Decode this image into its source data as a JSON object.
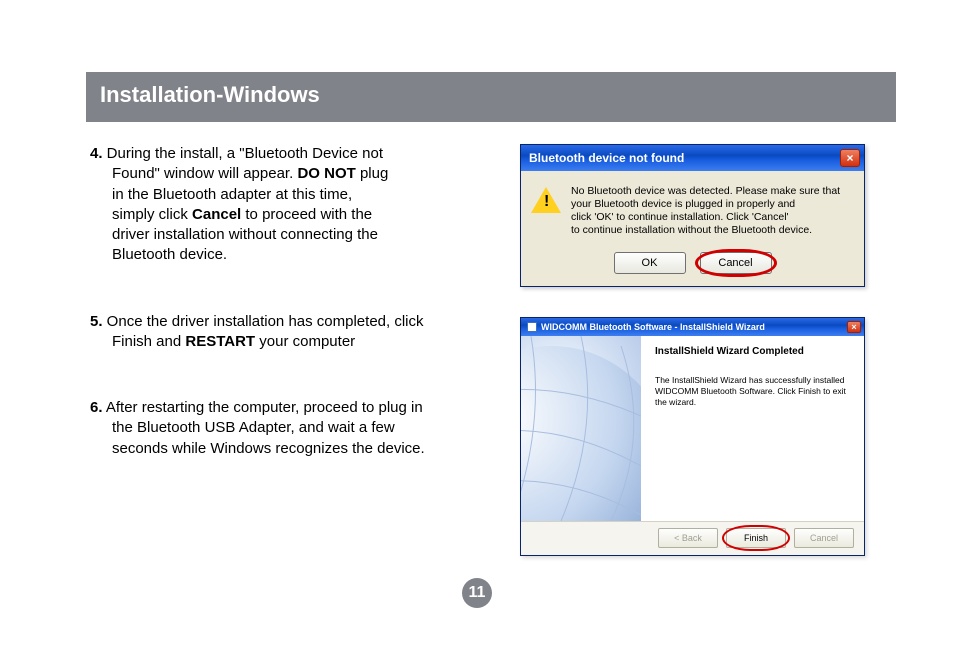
{
  "header": {
    "title": "Installation-Windows"
  },
  "steps": {
    "s4": {
      "num": "4.",
      "t1": " During the install, a \"Bluetooth Device not",
      "t2": "Found\" window will appear.  ",
      "b1": "DO NOT",
      "t3": " plug",
      "t4": "in the Bluetooth adapter at this time,",
      "t5": " simply click ",
      "b2": "Cancel",
      "t6": " to proceed with the",
      "t7": "driver installation without connecting the",
      "t8": "Bluetooth device."
    },
    "s5": {
      "num": "5.",
      "t1": " Once the driver installation has completed, click",
      "t2": " Finish and ",
      "b1": "RESTART",
      "t3": " your computer"
    },
    "s6": {
      "num": "6.",
      "t1": " After restarting the computer, proceed to plug in",
      "t2": " the Bluetooth USB Adapter, and wait a few",
      "t3": " seconds while Windows recognizes the device."
    }
  },
  "dialog1": {
    "title": "Bluetooth device not found",
    "msg_l1": "No Bluetooth device was detected. Please make sure that",
    "msg_l2": "your Bluetooth device is plugged in properly and",
    "msg_l3": "click 'OK' to continue installation. Click 'Cancel'",
    "msg_l4": "to continue installation without the Bluetooth device.",
    "ok": "OK",
    "cancel": "Cancel"
  },
  "dialog2": {
    "title": "WIDCOMM Bluetooth Software - InstallShield Wizard",
    "heading": "InstallShield Wizard Completed",
    "body": "The InstallShield Wizard has successfully installed WIDCOMM Bluetooth Software. Click Finish to exit the wizard.",
    "back": "< Back",
    "finish": "Finish",
    "cancel": "Cancel"
  },
  "page_number": "11"
}
